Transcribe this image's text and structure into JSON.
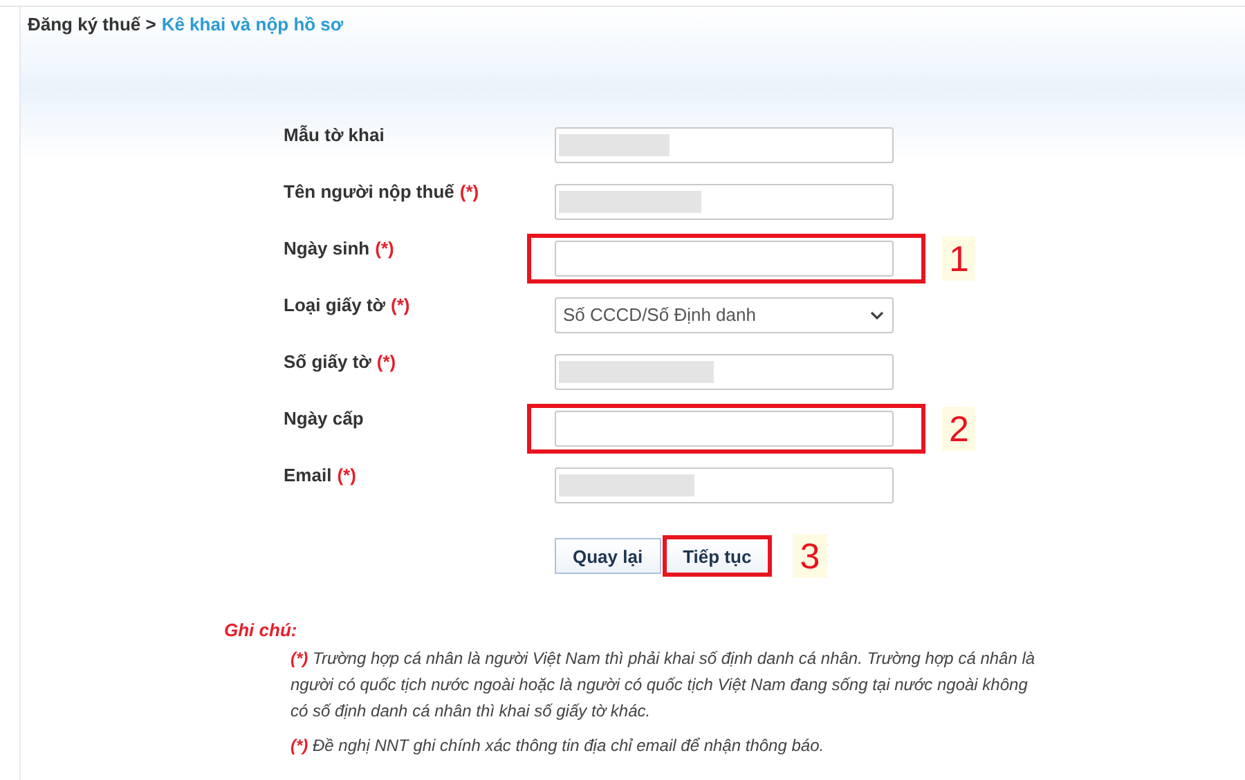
{
  "breadcrumb": {
    "parent": "Đăng ký thuế >",
    "current": "Kê khai và nộp hồ sơ"
  },
  "fields": [
    {
      "label": "Mẫu tờ khai",
      "required": false,
      "kind": "input",
      "redacted": true,
      "highlighted": false
    },
    {
      "label": "Tên người nộp thuế",
      "required": true,
      "kind": "input",
      "redacted": true,
      "highlighted": false
    },
    {
      "label": "Ngày sinh",
      "required": true,
      "kind": "input",
      "redacted": false,
      "highlighted": true,
      "marker": "1"
    },
    {
      "label": "Loại giấy tờ",
      "required": true,
      "kind": "select",
      "value": "Số CCCD/Số Định danh",
      "redacted": false,
      "highlighted": false
    },
    {
      "label": "Số giấy tờ",
      "required": true,
      "kind": "input",
      "redacted": true,
      "highlighted": false
    },
    {
      "label": "Ngày cấp",
      "required": false,
      "kind": "input",
      "redacted": false,
      "highlighted": true,
      "marker": "2"
    },
    {
      "label": "Email",
      "required": true,
      "kind": "input",
      "redacted": true,
      "highlighted": false
    }
  ],
  "required_mark": "(*)",
  "buttons": [
    {
      "label": "Quay lại",
      "highlighted": false
    },
    {
      "label": "Tiếp tục",
      "highlighted": true,
      "marker": "3"
    }
  ],
  "notes": {
    "title": "Ghi chú:",
    "items": [
      {
        "mark": "(*)",
        "text": "Trường hợp cá nhân là người Việt Nam thì phải khai số định danh cá nhân. Trường hợp cá nhân là người có quốc tịch nước ngoài hoặc là người có quốc tịch Việt Nam đang sống tại nước ngoài không có số định danh cá nhân thì khai số giấy tờ khác."
      },
      {
        "mark": "(*)",
        "text": "Đề nghị NNT ghi chính xác thông tin địa chỉ email để nhận thông báo."
      }
    ]
  }
}
